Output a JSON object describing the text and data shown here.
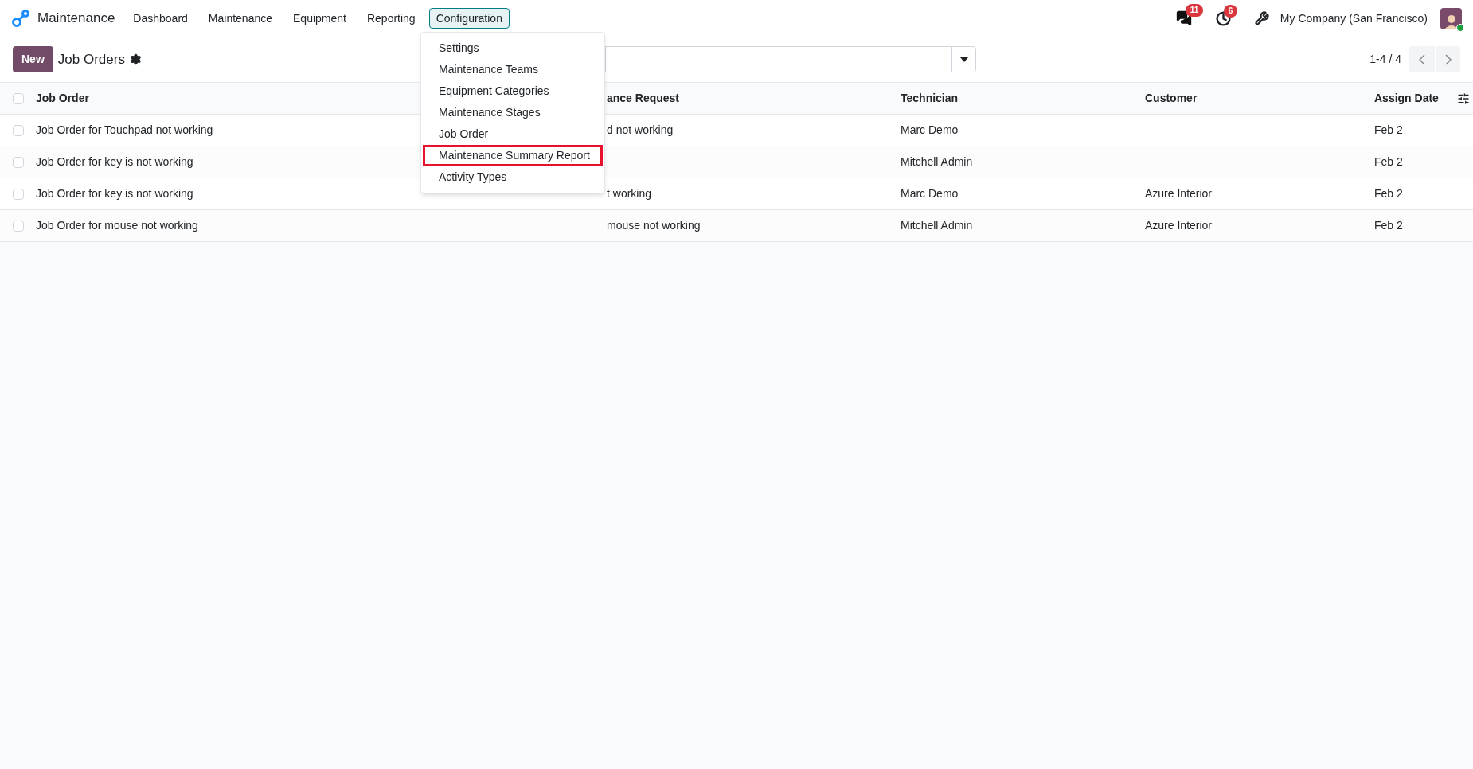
{
  "navbar": {
    "app_name": "Maintenance",
    "menu": [
      {
        "label": "Dashboard",
        "selected": false
      },
      {
        "label": "Maintenance",
        "selected": false
      },
      {
        "label": "Equipment",
        "selected": false
      },
      {
        "label": "Reporting",
        "selected": false
      },
      {
        "label": "Configuration",
        "selected": true
      }
    ],
    "messages_badge": "11",
    "activities_badge": "6",
    "company": "My Company (San Francisco)"
  },
  "control_panel": {
    "new_button": "New",
    "title": "Job Orders",
    "pager": "1-4 / 4"
  },
  "table": {
    "select_all_checked": false,
    "columns": [
      "Job Order",
      "ance Request",
      "Technician",
      "Customer",
      "Assign Date"
    ],
    "rows": [
      {
        "checked": false,
        "job_order": "Job Order for Touchpad not working",
        "column_2": "d not working",
        "technician": "Marc Demo",
        "assign_date": "Feb 2"
      },
      {
        "checked": false,
        "job_order": "Job Order for key is not working",
        "technician": "Mitchell Admin",
        "assign_date": "Feb 2"
      },
      {
        "checked": false,
        "job_order": "Job Order for key is not working",
        "column_2": "t working",
        "technician": "Marc Demo",
        "customer": "Azure Interior",
        "assign_date": "Feb 2"
      },
      {
        "checked": false,
        "job_order": "Job Order for mouse not working",
        "column_2": "mouse not working",
        "technician": "Mitchell Admin",
        "customer": "Azure Interior",
        "assign_date": "Feb 2"
      }
    ]
  },
  "dropdown": {
    "items": [
      {
        "label": "Settings",
        "highlighted": false
      },
      {
        "label": "Maintenance Teams",
        "highlighted": false
      },
      {
        "label": "Equipment Categories",
        "highlighted": false
      },
      {
        "label": "Maintenance Stages",
        "highlighted": false
      },
      {
        "label": "Job Order",
        "highlighted": false
      },
      {
        "label": "Maintenance Summary Report",
        "highlighted": true
      },
      {
        "label": "Activity Types",
        "highlighted": false
      }
    ]
  }
}
